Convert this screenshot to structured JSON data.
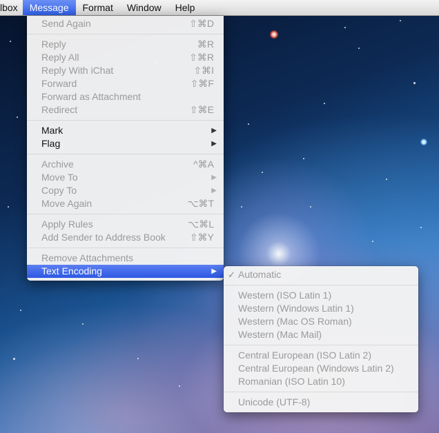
{
  "menubar": {
    "items": [
      "lbox",
      "Message",
      "Format",
      "Window",
      "Help"
    ],
    "active_index": 1
  },
  "message_menu": {
    "groups": [
      [
        {
          "label": "Send Again",
          "shortcut": "⇧⌘D",
          "enabled": false
        }
      ],
      [
        {
          "label": "Reply",
          "shortcut": "⌘R",
          "enabled": false
        },
        {
          "label": "Reply All",
          "shortcut": "⇧⌘R",
          "enabled": false
        },
        {
          "label": "Reply With iChat",
          "shortcut": "⇧⌘I",
          "enabled": false
        },
        {
          "label": "Forward",
          "shortcut": "⇧⌘F",
          "enabled": false
        },
        {
          "label": "Forward as Attachment",
          "shortcut": "",
          "enabled": false
        },
        {
          "label": "Redirect",
          "shortcut": "⇧⌘E",
          "enabled": false
        }
      ],
      [
        {
          "label": "Mark",
          "submenu": true,
          "enabled": true
        },
        {
          "label": "Flag",
          "submenu": true,
          "enabled": true
        }
      ],
      [
        {
          "label": "Archive",
          "shortcut": "^⌘A",
          "enabled": false
        },
        {
          "label": "Move To",
          "submenu": true,
          "enabled": false
        },
        {
          "label": "Copy To",
          "submenu": true,
          "enabled": false
        },
        {
          "label": "Move Again",
          "shortcut": "⌥⌘T",
          "enabled": false
        }
      ],
      [
        {
          "label": "Apply Rules",
          "shortcut": "⌥⌘L",
          "enabled": false
        },
        {
          "label": "Add Sender to Address Book",
          "shortcut": "⇧⌘Y",
          "enabled": false
        }
      ],
      [
        {
          "label": "Remove Attachments",
          "shortcut": "",
          "enabled": false
        },
        {
          "label": "Text Encoding",
          "submenu": true,
          "enabled": true,
          "highlighted": true
        }
      ]
    ]
  },
  "encoding_menu": {
    "groups": [
      [
        {
          "label": "Automatic",
          "checked": true
        }
      ],
      [
        {
          "label": "Western (ISO Latin 1)"
        },
        {
          "label": "Western (Windows Latin 1)"
        },
        {
          "label": "Western (Mac OS Roman)"
        },
        {
          "label": "Western (Mac Mail)"
        }
      ],
      [
        {
          "label": "Central European (ISO Latin 2)"
        },
        {
          "label": "Central European (Windows Latin 2)"
        },
        {
          "label": "Romanian (ISO Latin 10)"
        }
      ],
      [
        {
          "label": "Unicode (UTF-8)"
        }
      ]
    ],
    "check_glyph": "✓"
  },
  "icons": {
    "submenu_arrow": "▶"
  }
}
